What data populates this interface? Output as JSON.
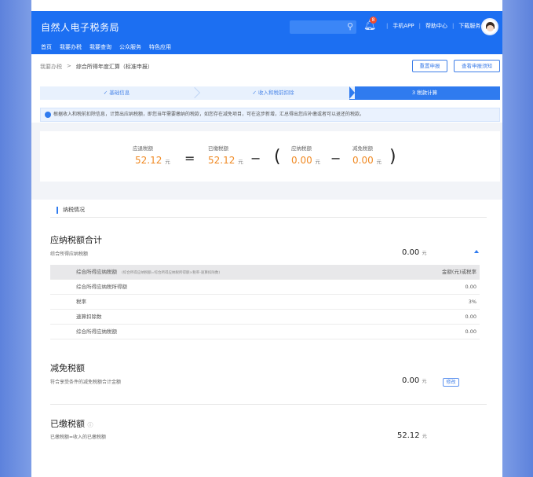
{
  "header": {
    "brand": "自然人电子税务局",
    "notification_badge": "8",
    "links": [
      "手机APP",
      "帮助中心",
      "下载服务"
    ],
    "nav": [
      "首页",
      "我要办税",
      "我要查询",
      "公众服务",
      "特色应用"
    ]
  },
  "breadcrumb": {
    "parent": "我要办税",
    "separator": ">",
    "current": "综合所得年度汇算（标准申报）"
  },
  "actions": {
    "reset": "重置申报",
    "notice": "查看申报须知"
  },
  "steps": [
    {
      "label": "✓ 基础信息"
    },
    {
      "label": "✓ 收入和税前扣除"
    },
    {
      "label": "3 税款计算"
    }
  ],
  "info_text": "根据收入和税前扣除信息，计算出应纳税额，即您当年需要缴纳的税款，如您存在减免项目，可在这步新增，汇总得出您应补缴或者可以退还的税款。",
  "summary": {
    "refund": {
      "label": "应退税额",
      "value": "52.12",
      "unit": "元"
    },
    "equals": "=",
    "paid": {
      "label": "已缴税额",
      "value": "52.12",
      "unit": "元"
    },
    "minus": "−",
    "open_paren": "(",
    "payable": {
      "label": "应纳税额",
      "value": "0.00",
      "unit": "元"
    },
    "minus2": "−",
    "reduction": {
      "label": "减免税额",
      "value": "0.00",
      "unit": "元"
    },
    "close_paren": ")"
  },
  "section": {
    "title": "纳税情况"
  },
  "payable_block": {
    "title": "应纳税额合计",
    "subtitle": "综合所得应纳税额",
    "amount": "0.00",
    "unit": "元",
    "table": {
      "header": {
        "col1": "综合所得应纳税额",
        "col1_formula": "(综合所得应纳税额=综合所得应纳税所得额×税率-速算扣除数)",
        "col2": "金额(元)或税率"
      },
      "rows": [
        {
          "name": "综合所得应纳税所得额",
          "value": "0.00"
        },
        {
          "name": "税率",
          "value": "3%"
        },
        {
          "name": "速算扣除数",
          "value": "0.00"
        },
        {
          "name": "综合所得应纳税额",
          "value": "0.00"
        }
      ]
    }
  },
  "reduction_block": {
    "title": "减免税额",
    "subtitle": "符合享受条件的减免税额合计金额",
    "amount": "0.00",
    "unit": "元",
    "edit": "修改"
  },
  "paid_block": {
    "title": "已缴税额",
    "info_icon": "ⓘ",
    "subtitle": "已缴税额=收入的已缴税额",
    "amount": "52.12",
    "unit": "元"
  },
  "colors": {
    "primary": "#1c6ff2",
    "accent_orange": "#f08a24",
    "page_bg": "#6b8ee0"
  }
}
